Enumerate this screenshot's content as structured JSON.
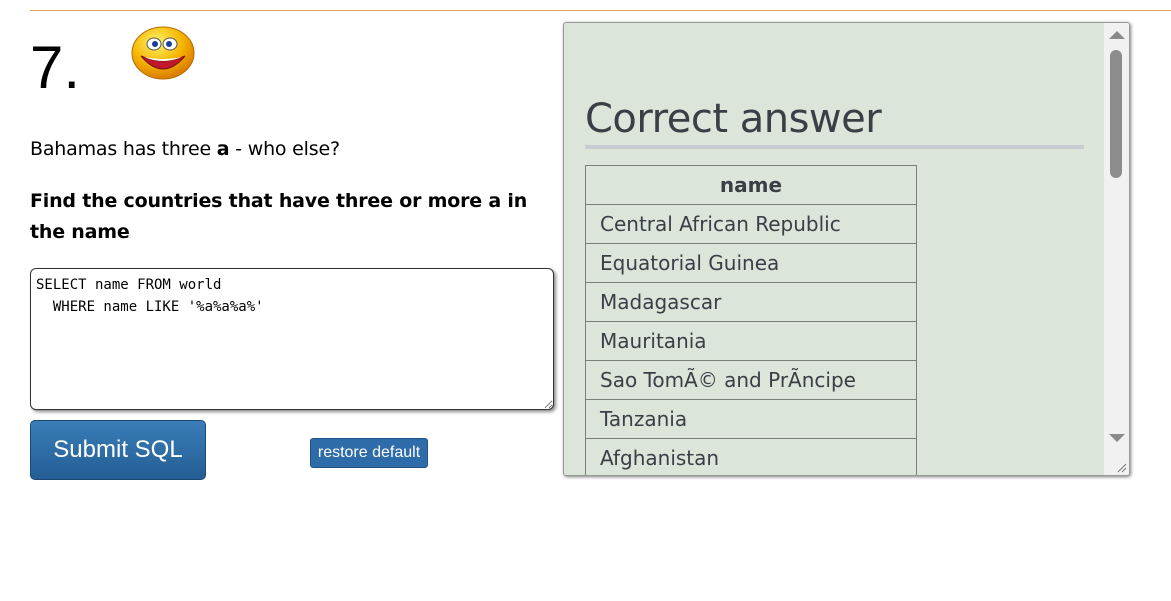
{
  "question": {
    "number": "7.",
    "intro_before": "Bahamas has three ",
    "intro_bold": "a",
    "intro_after": " - who else?",
    "task": "Find the countries that have three or more a in the name"
  },
  "editor": {
    "sql": "SELECT name FROM world\n  WHERE name LIKE '%a%a%a%'"
  },
  "buttons": {
    "submit_label": "Submit SQL",
    "restore_label": "restore default"
  },
  "answer": {
    "title": "Correct answer",
    "column_header": "name",
    "rows": [
      "Central African Republic",
      "Equatorial Guinea",
      "Madagascar",
      "Mauritania",
      "Sao TomÃ© and PrÃncipe",
      "Tanzania",
      "Afghanistan"
    ]
  },
  "icons": {
    "smiley": "smiley-face-icon"
  },
  "colors": {
    "rule": "#e3a857",
    "button_blue": "#2d6ca8",
    "answer_background": "#dbe5da"
  }
}
